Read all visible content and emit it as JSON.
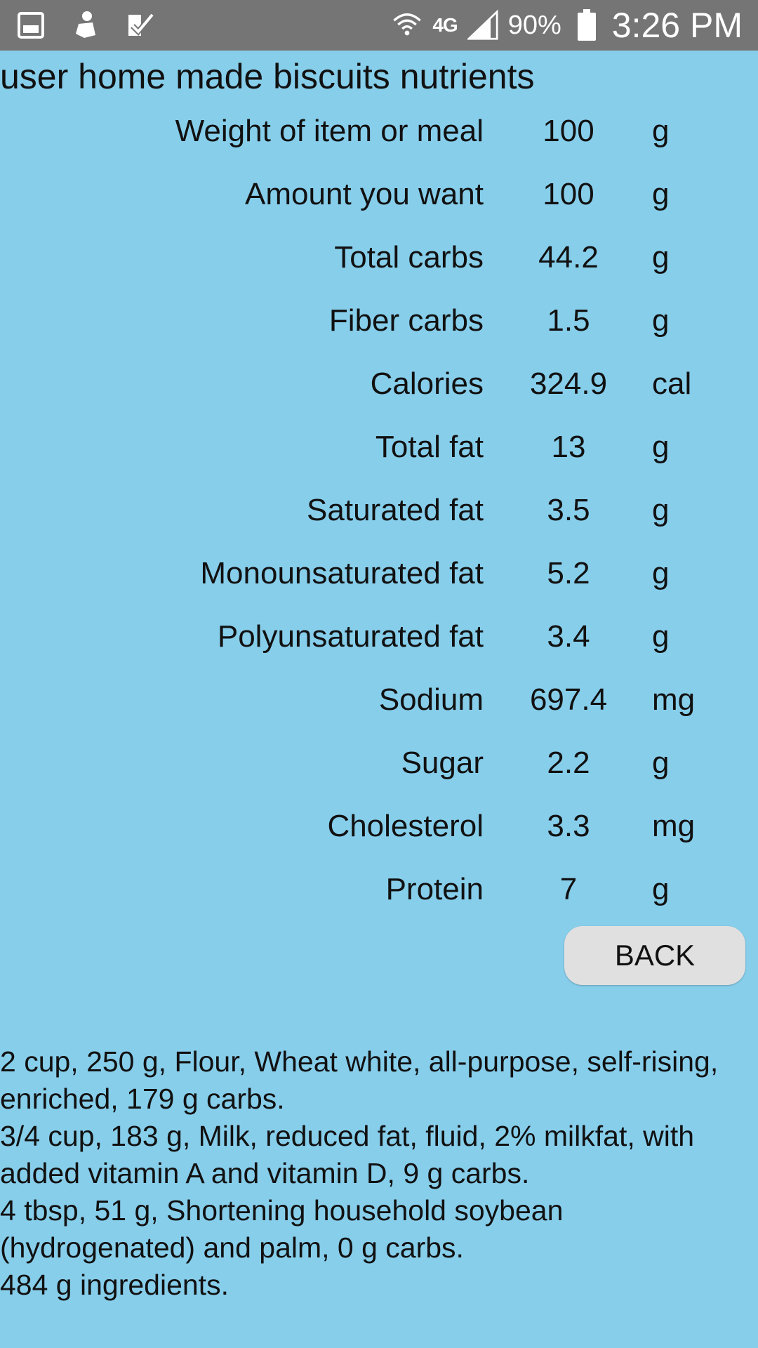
{
  "status_bar": {
    "icons_left": [
      "gallery-icon",
      "notification-app-icon",
      "task-check-icon"
    ],
    "network": "4G",
    "battery": "90%",
    "time": "3:26 PM"
  },
  "title": "user home made biscuits nutrients",
  "nutrients": [
    {
      "label": "Weight of item or meal",
      "value": "100",
      "unit": "g"
    },
    {
      "label": "Amount you want",
      "value": "100",
      "unit": "g"
    },
    {
      "label": "Total carbs",
      "value": "44.2",
      "unit": "g"
    },
    {
      "label": "Fiber carbs",
      "value": "1.5",
      "unit": "g"
    },
    {
      "label": "Calories",
      "value": "324.9",
      "unit": "cal"
    },
    {
      "label": "Total fat",
      "value": "13",
      "unit": "g"
    },
    {
      "label": "Saturated fat",
      "value": "3.5",
      "unit": "g"
    },
    {
      "label": "Monounsaturated fat",
      "value": "5.2",
      "unit": "g"
    },
    {
      "label": "Polyunsaturated fat",
      "value": "3.4",
      "unit": "g"
    },
    {
      "label": "Sodium",
      "value": "697.4",
      "unit": "mg"
    },
    {
      "label": "Sugar",
      "value": "2.2",
      "unit": "g"
    },
    {
      "label": "Cholesterol",
      "value": "3.3",
      "unit": "mg"
    },
    {
      "label": "Protein",
      "value": "7",
      "unit": "g"
    }
  ],
  "back_label": "BACK",
  "ingredients": [
    "2 cup, 250 g, Flour, Wheat white, all-purpose, self-rising, enriched, 179 g carbs.",
    "3/4 cup, 183 g, Milk, reduced fat, fluid, 2% milkfat, with added vitamin A and vitamin D, 9 g carbs.",
    "4 tbsp, 51 g, Shortening household soybean (hydrogenated) and palm, 0 g carbs.",
    "484 g ingredients."
  ]
}
